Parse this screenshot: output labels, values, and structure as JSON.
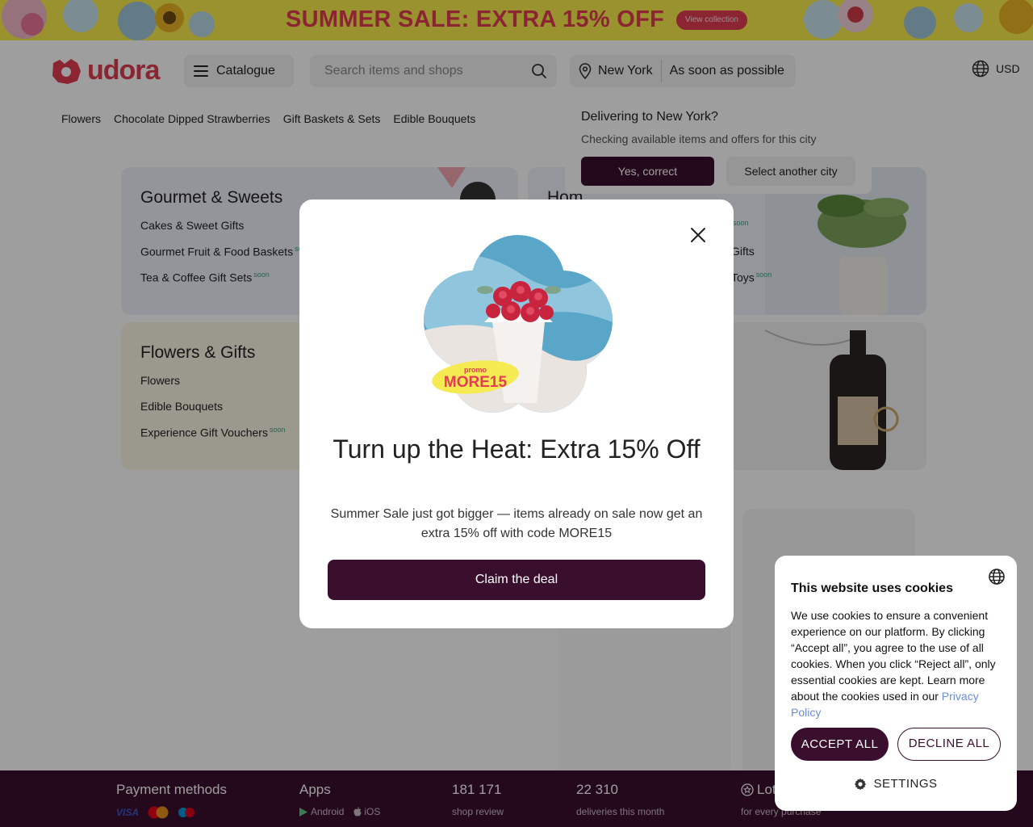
{
  "banner": {
    "title": "SUMMER SALE: EXTRA 15% OFF",
    "button": "View collection"
  },
  "header": {
    "logo": "udora",
    "catalogue": "Catalogue",
    "search_placeholder": "Search items and shops",
    "city": "New York",
    "delivery_time": "As soon as possible",
    "currency": "USD"
  },
  "nav": [
    "Flowers",
    "Chocolate Dipped Strawberries",
    "Gift Baskets & Sets",
    "Edible Bouquets"
  ],
  "cards": [
    {
      "title": "Gourmet & Sweets",
      "items": [
        {
          "label": "Cakes & Sweet Gifts",
          "soon": ""
        },
        {
          "label": "Gourmet Fruit & Food Baskets",
          "soon": "soon"
        },
        {
          "label": "Tea & Coffee Gift Sets",
          "soon": "soon"
        }
      ]
    },
    {
      "title": "Hom",
      "items": [
        {
          "label": "",
          "soon": "soon"
        },
        {
          "label": "Gifts",
          "soon": ""
        },
        {
          "label": "Toys",
          "soon": "soon"
        }
      ]
    },
    {
      "title": "Flowers & Gifts",
      "items": [
        {
          "label": "Flowers",
          "soon": ""
        },
        {
          "label": "Edible Bouquets",
          "soon": ""
        },
        {
          "label": "Experience Gift Vouchers",
          "soon": "soon"
        }
      ]
    }
  ],
  "deliver_popover": {
    "title": "Delivering to New York?",
    "text": "Checking available items and offers for this city",
    "confirm": "Yes, correct",
    "other": "Select another city"
  },
  "modal": {
    "promo_label": "promo",
    "promo_code": "MORE15",
    "title": "Turn up the Heat: Extra 15% Off",
    "description": "Summer Sale just got bigger — items already on sale now get an extra 15% off with code MORE15",
    "cta": "Claim the deal"
  },
  "footer": {
    "payment_title": "Payment methods",
    "apps_title": "Apps",
    "android": "Android",
    "ios": "iOS",
    "reviews_count": "181 171",
    "reviews_label": "shop review",
    "deliveries_count": "22 310",
    "deliveries_label": "deliveries this month",
    "loyalty_title": "Lot",
    "loyalty_label": "for every purchase"
  },
  "cookie": {
    "title": "This website uses cookies",
    "text": "We use cookies to ensure a convenient experience on our platform. By clicking “Accept all”, you agree to the use of all cookies. When you click “Reject all”, only essential cookies are kept. Learn more about the cookies used in our",
    "link": "Privacy Policy",
    "accept": "ACCEPT ALL",
    "decline": "DECLINE ALL",
    "settings": "SETTINGS"
  },
  "colors": {
    "brand": "#e23d52",
    "primary": "#3a0f2e",
    "banner_bg": "#f7ec4d"
  }
}
